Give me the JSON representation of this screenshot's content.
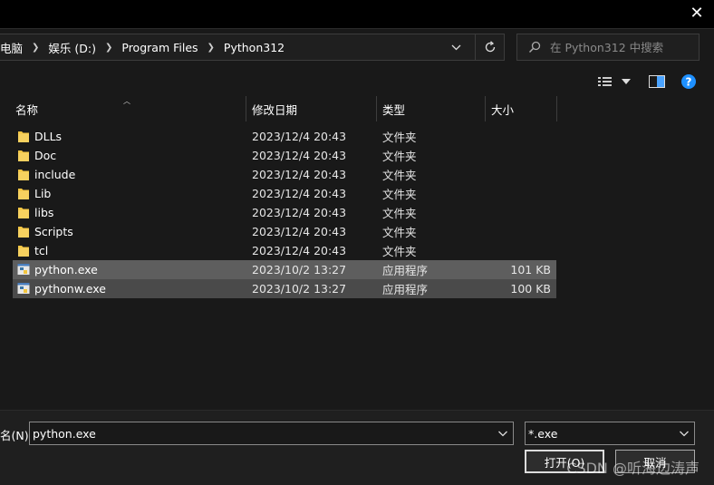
{
  "breadcrumb": {
    "items": [
      "电脑",
      "娱乐 (D:)",
      "Program Files",
      "Python312"
    ]
  },
  "search": {
    "placeholder": "在 Python312 中搜索"
  },
  "columns": {
    "name": "名称",
    "modified": "修改日期",
    "type": "类型",
    "size": "大小"
  },
  "files": [
    {
      "name": "DLLs",
      "modified": "2023/12/4 20:43",
      "type": "文件夹",
      "size": "",
      "icon": "folder-icon"
    },
    {
      "name": "Doc",
      "modified": "2023/12/4 20:43",
      "type": "文件夹",
      "size": "",
      "icon": "folder-icon"
    },
    {
      "name": "include",
      "modified": "2023/12/4 20:43",
      "type": "文件夹",
      "size": "",
      "icon": "folder-icon"
    },
    {
      "name": "Lib",
      "modified": "2023/12/4 20:43",
      "type": "文件夹",
      "size": "",
      "icon": "folder-icon"
    },
    {
      "name": "libs",
      "modified": "2023/12/4 20:43",
      "type": "文件夹",
      "size": "",
      "icon": "folder-icon"
    },
    {
      "name": "Scripts",
      "modified": "2023/12/4 20:43",
      "type": "文件夹",
      "size": "",
      "icon": "folder-icon"
    },
    {
      "name": "tcl",
      "modified": "2023/12/4 20:43",
      "type": "文件夹",
      "size": "",
      "icon": "folder-icon"
    },
    {
      "name": "python.exe",
      "modified": "2023/10/2 13:27",
      "type": "应用程序",
      "size": "101 KB",
      "icon": "python-icon"
    },
    {
      "name": "pythonw.exe",
      "modified": "2023/10/2 13:27",
      "type": "应用程序",
      "size": "100 KB",
      "icon": "python-icon"
    }
  ],
  "bottom": {
    "filename_label": "名(N):",
    "filename_value": "python.exe",
    "filetype_value": "*.exe",
    "open_label": "打开(O)",
    "cancel_label": "取消",
    "watermark": "CSDN @听海边涛声"
  },
  "colors": {
    "folder": "#f4c542",
    "selected": "#5e5e5e",
    "help": "#1e90ff"
  }
}
